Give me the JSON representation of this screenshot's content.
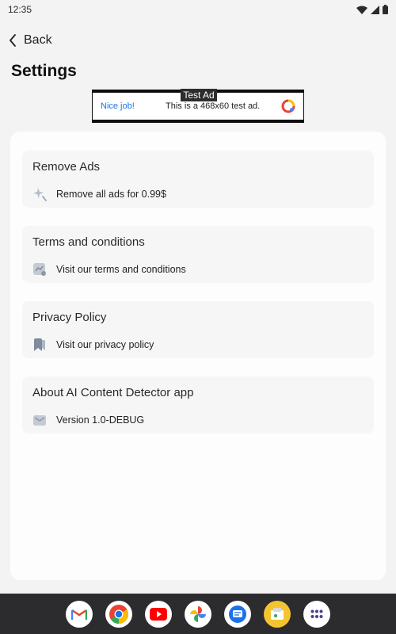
{
  "status_bar": {
    "time": "12:35",
    "icons": [
      "wifi-icon",
      "signal-icon",
      "battery-icon"
    ]
  },
  "header": {
    "back_label": "Back",
    "title": "Settings"
  },
  "ad": {
    "tag": "Test Ad",
    "headline": "Nice job!",
    "text": "This is a 468x60 test ad."
  },
  "sections": [
    {
      "title": "Remove Ads",
      "text": "Remove all ads for 0.99$",
      "icon": "sparkle-icon"
    },
    {
      "title": "Terms and conditions",
      "text": "Visit our terms and conditions",
      "icon": "document-chart-icon"
    },
    {
      "title": "Privacy Policy",
      "text": "Visit our privacy policy",
      "icon": "bookmark-icon"
    },
    {
      "title": "About AI Content Detector app",
      "text": "Version 1.0-DEBUG",
      "icon": "mail-icon"
    }
  ],
  "dock": {
    "apps": [
      "gmail-icon",
      "chrome-icon",
      "youtube-icon",
      "photos-icon",
      "messages-icon",
      "files-icon",
      "app-drawer-icon"
    ]
  },
  "colors": {
    "background": "#f3f3f3",
    "card": "#fdfdfd",
    "section": "#f6f6f6",
    "ad_link": "#1a73e8",
    "dock": "#2c2c2e"
  }
}
